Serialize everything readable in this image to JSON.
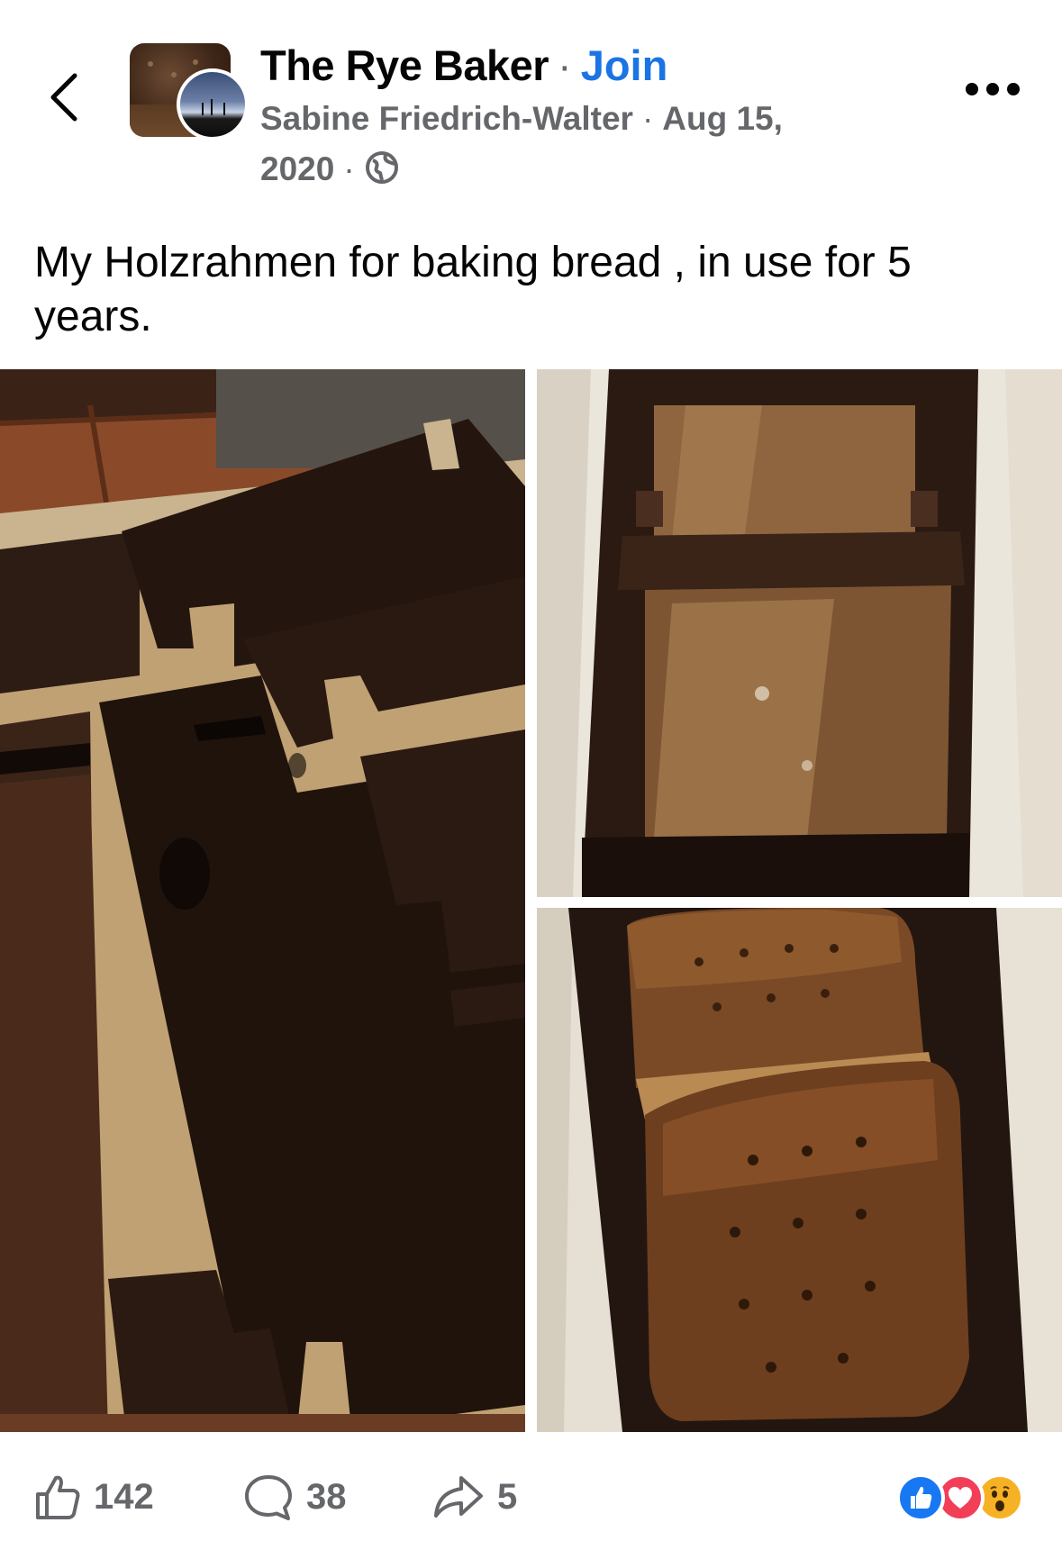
{
  "header": {
    "group_name": "The Rye Baker",
    "separator": "·",
    "join_label": "Join",
    "author": "Sabine Friedrich-Walter",
    "date": "Aug 15, 2020",
    "privacy_icon": "globe-icon",
    "back_icon": "chevron-left-icon",
    "more_icon": "more-horizontal-icon"
  },
  "post": {
    "caption": "My Holzrahmen for baking bread , in use for 5 years.",
    "photos": [
      {
        "name": "wooden-frame-pieces-photo"
      },
      {
        "name": "assembled-frame-photo"
      },
      {
        "name": "baked-loaf-photo"
      }
    ]
  },
  "footer": {
    "likes": "142",
    "comments": "38",
    "shares": "5",
    "reactions": [
      "like",
      "love",
      "wow"
    ]
  },
  "colors": {
    "accent": "#1b74e4",
    "secondary_text": "#65676b",
    "primary_text": "#050505",
    "like_reaction": "#1877f2",
    "love_reaction": "#f33e58",
    "wow_reaction": "#f7b125"
  }
}
